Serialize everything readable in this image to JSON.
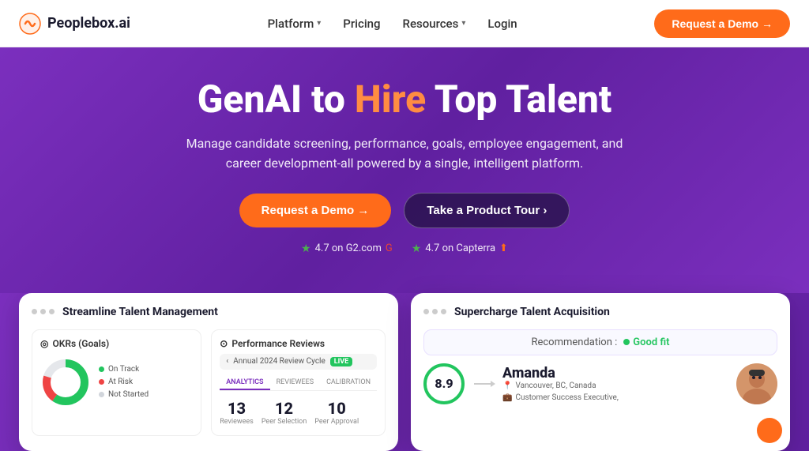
{
  "navbar": {
    "logo_text": "Peoplebox.ai",
    "nav_links": [
      {
        "label": "Platform",
        "has_dropdown": true
      },
      {
        "label": "Pricing",
        "has_dropdown": false
      },
      {
        "label": "Resources",
        "has_dropdown": true
      },
      {
        "label": "Login",
        "has_dropdown": false
      }
    ],
    "cta_label": "Request a Demo →"
  },
  "hero": {
    "title_part1": "GenAI to ",
    "title_highlight": "Hire",
    "title_part2": " Top Talent",
    "subtitle": "Manage candidate screening, performance, goals, employee engagement, and career development-all powered by a single, intelligent platform.",
    "btn_demo": "Request a Demo →",
    "btn_tour": "Take a Product Tour ›",
    "rating1": "4.7 on G2.com",
    "rating2": "4.7 on Capterra"
  },
  "cards": {
    "left": {
      "title": "Streamline Talent Management",
      "okr_panel_title": "OKRs (Goals)",
      "legend": [
        {
          "label": "On Track",
          "color": "#22C55E"
        },
        {
          "label": "At Risk",
          "color": "#EF4444"
        },
        {
          "label": "Not Started",
          "color": "#D1D5DB"
        }
      ],
      "perf_title": "Performance Reviews",
      "cycle_label": "Annual 2024 Review Cycle",
      "live_badge": "LIVE",
      "tabs": [
        "ANALYTICS",
        "REVIEWEES",
        "CALIBRATION"
      ],
      "active_tab": "ANALYTICS",
      "stats": [
        {
          "num": "13",
          "label": "Reviewees"
        },
        {
          "num": "12",
          "label": "Peer Selection"
        },
        {
          "num": "10",
          "label": "Peer Approval"
        }
      ]
    },
    "right": {
      "title": "Supercharge Talent Acquisition",
      "recommendation_label": "Recommendation :",
      "good_fit_label": "Good fit",
      "score": "8.9",
      "candidate_name": "Amanda",
      "location": "Vancouver, BC, Canada",
      "role": "Customer Success Executive,"
    }
  }
}
